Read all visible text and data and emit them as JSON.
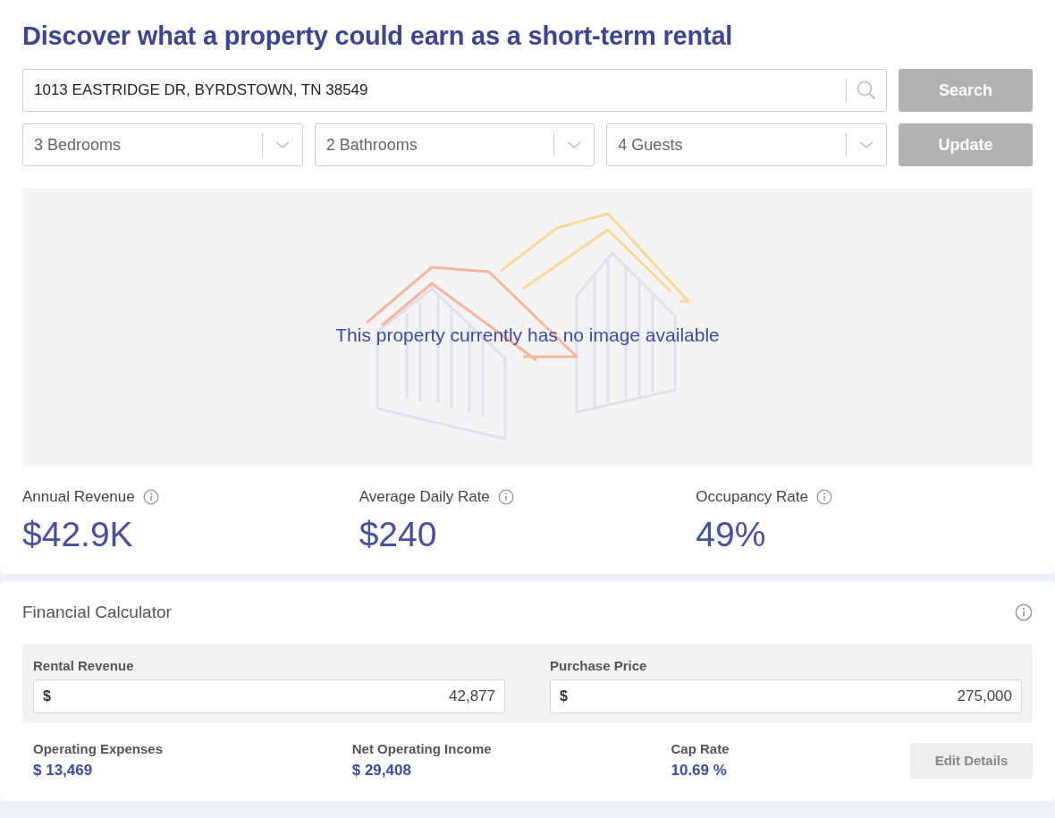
{
  "title": "Discover what a property could earn as a short-term rental",
  "search": {
    "value": "1013 EASTRIDGE DR, BYRDSTOWN, TN 38549",
    "button": {
      "label": "Search",
      "disabled": true
    }
  },
  "filters": [
    {
      "value": "3 Bedrooms"
    },
    {
      "value": "2 Bathrooms"
    },
    {
      "value": "4 Guests"
    }
  ],
  "update_button": {
    "label": "Update",
    "disabled": true
  },
  "image": {
    "message": "This property currently has no image available"
  },
  "stats": [
    {
      "label": "Annual Revenue",
      "value": "$42.9K"
    },
    {
      "label": "Average Daily Rate",
      "value": "$240"
    },
    {
      "label": "Occupancy Rate",
      "value": "49%"
    }
  ],
  "calculator": {
    "title": "Financial Calculator",
    "inputs": [
      {
        "label": "Rental Revenue",
        "prefix": "$",
        "value": "42,877"
      },
      {
        "label": "Purchase Price",
        "prefix": "$",
        "value": "275,000"
      }
    ],
    "results": [
      {
        "label": "Operating Expenses",
        "value": "$ 13,469"
      },
      {
        "label": "Net Operating Income",
        "value": "$ 29,408"
      },
      {
        "label": "Cap Rate",
        "value": "10.69 %"
      }
    ],
    "edit_button": "Edit Details"
  }
}
